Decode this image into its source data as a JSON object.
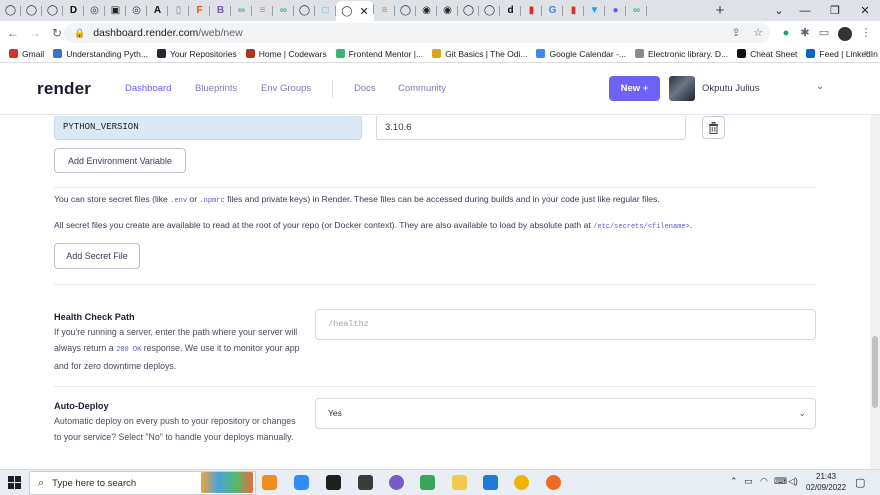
{
  "browser": {
    "tab_favicons": [
      {
        "name": "github-icon",
        "color": "#24292f",
        "glyph": "◯"
      },
      {
        "name": "github-icon",
        "color": "#24292f",
        "glyph": "◯"
      },
      {
        "name": "github-icon",
        "color": "#24292f",
        "glyph": "◯"
      },
      {
        "name": "dev-icon",
        "color": "#0a0a0a",
        "glyph": "D"
      },
      {
        "name": "media-icon",
        "color": "#333",
        "glyph": "◎"
      },
      {
        "name": "codewars-icon",
        "color": "#222",
        "glyph": "▣"
      },
      {
        "name": "media-icon",
        "color": "#333",
        "glyph": "◎"
      },
      {
        "name": "kaggle-icon",
        "color": "#111",
        "glyph": "A"
      },
      {
        "name": "page-icon",
        "color": "#888",
        "glyph": "▯"
      },
      {
        "name": "figma-icon",
        "color": "#f24e1e",
        "glyph": "F"
      },
      {
        "name": "bootstrap-icon",
        "color": "#7952b3",
        "glyph": "B"
      },
      {
        "name": "frontend-mentor-icon",
        "color": "#3cb371",
        "glyph": "∞"
      },
      {
        "name": "stack-icon",
        "color": "#f48024",
        "glyph": "≡"
      },
      {
        "name": "frontend-mentor-icon",
        "color": "#3cb371",
        "glyph": "∞"
      },
      {
        "name": "github-icon",
        "color": "#24292f",
        "glyph": "◯"
      },
      {
        "name": "render-icon",
        "color": "#4fb8e0",
        "glyph": "□"
      },
      {
        "name": "github-icon",
        "color": "#24292f",
        "glyph": "◯"
      },
      {
        "name": "stack-icon",
        "color": "#f48024",
        "glyph": "≡"
      },
      {
        "name": "github-icon",
        "color": "#24292f",
        "glyph": "◯"
      },
      {
        "name": "codewars-icon",
        "color": "#222",
        "glyph": "◉"
      },
      {
        "name": "codewars-icon",
        "color": "#222",
        "glyph": "◉"
      },
      {
        "name": "github-icon",
        "color": "#24292f",
        "glyph": "◯"
      },
      {
        "name": "github-icon",
        "color": "#24292f",
        "glyph": "◯"
      },
      {
        "name": "dev-icon",
        "color": "#0a0a0a",
        "glyph": "d"
      },
      {
        "name": "app-icon",
        "color": "#d93025",
        "glyph": "▮"
      },
      {
        "name": "google-icon",
        "color": "#4285f4",
        "glyph": "G"
      },
      {
        "name": "app-icon",
        "color": "#d93025",
        "glyph": "▮"
      },
      {
        "name": "twitter-icon",
        "color": "#1da1f2",
        "glyph": "▼"
      },
      {
        "name": "messenger-icon",
        "color": "#7b4dff",
        "glyph": "●"
      },
      {
        "name": "frontend-mentor-icon",
        "color": "#3cb371",
        "glyph": "∞"
      }
    ],
    "active_tab_index": 16,
    "url_host": "dashboard.render.com",
    "url_path": "/web/new",
    "bookmarks": [
      {
        "label": "Gmail",
        "color": "#d93025"
      },
      {
        "label": "Understanding Pyth...",
        "color": "#3a6fd8"
      },
      {
        "label": "Your Repositories",
        "color": "#24292f"
      },
      {
        "label": "Home | Codewars",
        "color": "#b1361e"
      },
      {
        "label": "Frontend Mentor |...",
        "color": "#3cb371"
      },
      {
        "label": "Git Basics | The Odi...",
        "color": "#d9a520"
      },
      {
        "label": "Google Calendar -...",
        "color": "#4285f4"
      },
      {
        "label": "Electronic library. D...",
        "color": "#8a8a8a"
      },
      {
        "label": "Cheat Sheet",
        "color": "#111"
      },
      {
        "label": "Feed | LinkedIn",
        "color": "#0a66c2"
      }
    ]
  },
  "header": {
    "logo": "render",
    "nav": [
      "Dashboard",
      "Blueprints",
      "Env Groups"
    ],
    "nav_secondary": [
      "Docs",
      "Community"
    ],
    "new_button": "New +",
    "user_name": "Okputu Julius"
  },
  "env": {
    "key": "PYTHON_VERSION",
    "value": "3.10.6",
    "add_button": "Add Environment Variable"
  },
  "secrets": {
    "line1_a": "You can store secret files (like ",
    "line1_code1": ".env",
    "line1_b": " or ",
    "line1_code2": ".npmrc",
    "line1_c": " files and private keys) in Render. These files can be accessed during builds and in your code just like regular files.",
    "line2_a": "All secret files you create are available to read at the root of your repo (or Docker context). They are also available to load by absolute path at ",
    "line2_code": "/etc/secrets/<filename>",
    "line2_b": ".",
    "add_button": "Add Secret File"
  },
  "health_check": {
    "label": "Health Check Path",
    "desc_a": "If you're running a server, enter the path where your server will always return a ",
    "desc_code": "200 OK",
    "desc_b": " response. We use it to monitor your app and for zero downtime deploys.",
    "placeholder": "/healthz"
  },
  "auto_deploy": {
    "label": "Auto-Deploy",
    "desc": "Automatic deploy on every push to your repository or changes to your service? Select \"No\" to handle your deploys manually.",
    "value": "Yes"
  },
  "taskbar": {
    "search_placeholder": "Type here to search",
    "time": "21:43",
    "date": "02/09/2022"
  }
}
